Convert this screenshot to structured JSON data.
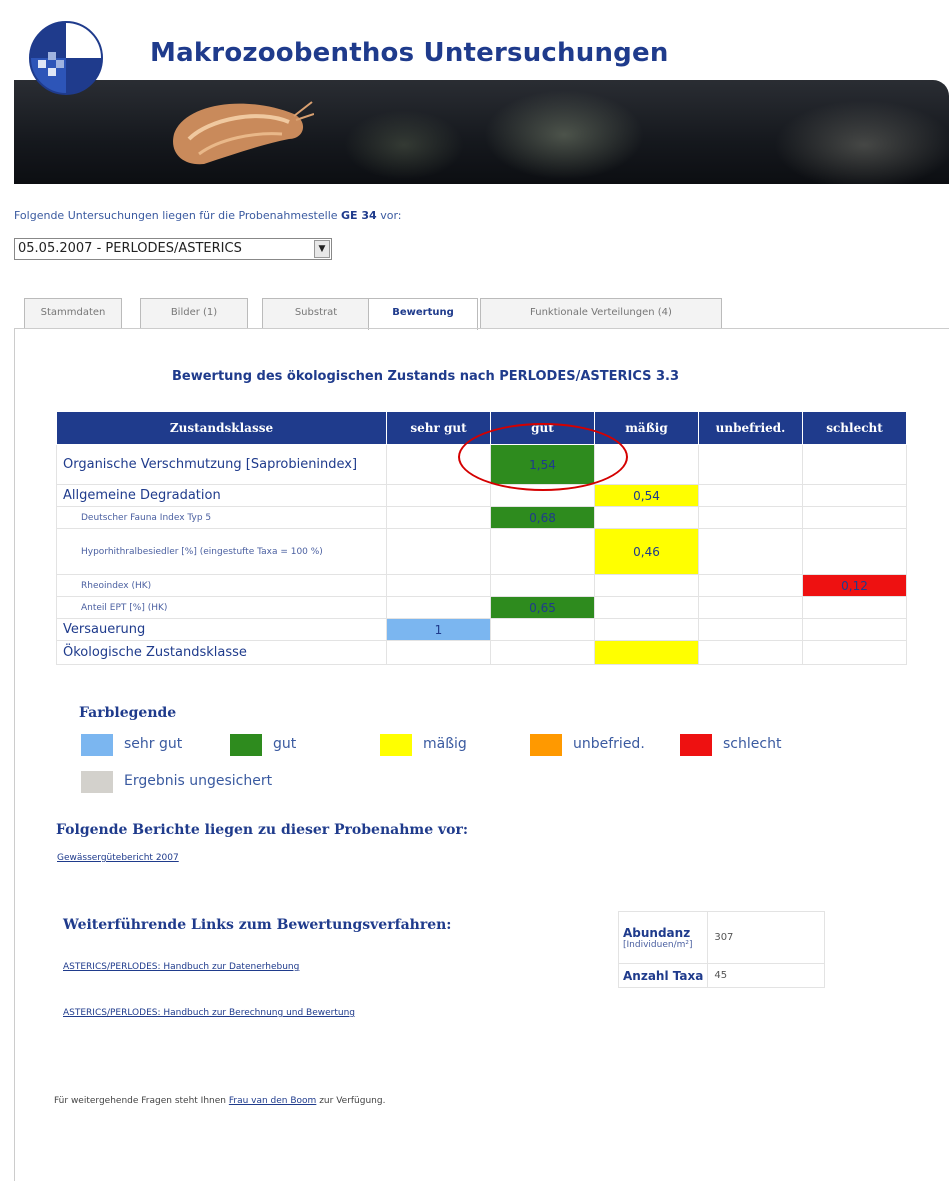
{
  "header": {
    "title": "Makrozoobenthos Untersuchungen"
  },
  "intro": {
    "text": "Folgende Untersuchungen liegen für die Probenahmestelle",
    "station": "GE 34",
    "suffix": "vor:"
  },
  "sample_select": {
    "value": "05.05.2007 - PERLODES/ASTERICS"
  },
  "tabs": [
    {
      "label": "Stammdaten"
    },
    {
      "label": "Bilder (1)"
    },
    {
      "label": "Substrat"
    },
    {
      "label": "Bewertung"
    },
    {
      "label": "Funktionale Verteilungen (4)"
    }
  ],
  "assessment": {
    "title": "Bewertung des ökologischen Zustands nach PERLODES/ASTERICS 3.3",
    "headers": [
      "Zustandsklasse",
      "sehr gut",
      "gut",
      "mäßig",
      "unbefried.",
      "schlecht"
    ],
    "rows": [
      {
        "label": "Organische Verschmutzung [Saprobienindex]",
        "value": "1,54",
        "class": "gut"
      },
      {
        "label": "Allgemeine Degradation",
        "value": "0,54",
        "class": "mäßig"
      },
      {
        "label": "Deutscher Fauna Index Typ 5",
        "value": "0,68",
        "class": "gut"
      },
      {
        "label": "Hyporhithralbesiedler [%] (eingestufte Taxa = 100 %)",
        "value": "0,46",
        "class": "mäßig"
      },
      {
        "label": "Rheoindex (HK)",
        "value": "0,12",
        "class": "schlecht"
      },
      {
        "label": "Anteil EPT [%] (HK)",
        "value": "0,65",
        "class": "gut"
      },
      {
        "label": "Versauerung",
        "value": "1",
        "class": "sehr gut"
      },
      {
        "label": "Ökologische Zustandsklasse",
        "value": "",
        "class": "mäßig"
      }
    ]
  },
  "legend": {
    "title": "Farblegende",
    "items": [
      {
        "label": "sehr gut",
        "color": "#7bb6f0"
      },
      {
        "label": "gut",
        "color": "#2e8b1e"
      },
      {
        "label": "mäßig",
        "color": "#ffff00"
      },
      {
        "label": "unbefried.",
        "color": "#ff9900"
      },
      {
        "label": "schlecht",
        "color": "#ee1111"
      },
      {
        "label": "Ergebnis ungesichert",
        "color": "#d3d1cc"
      }
    ]
  },
  "reports": {
    "title": "Folgende Berichte liegen zu dieser Probenahme vor:",
    "link": "Gewässergütebericht 2007"
  },
  "links": {
    "title": "Weiterführende Links zum Bewertungsverfahren:",
    "items": [
      "ASTERICS/PERLODES: Handbuch zur Datenerhebung",
      "ASTERICS/PERLODES: Handbuch zur Berechnung und Bewertung"
    ]
  },
  "stats": {
    "abundance_label": "Abundanz",
    "abundance_unit": "[Individuen/m²]",
    "abundance_value": "307",
    "taxa_label": "Anzahl Taxa",
    "taxa_value": "45"
  },
  "footer": {
    "prefix": "Für weitergehende Fragen steht Ihnen",
    "contact": "Frau van den Boom",
    "suffix": "zur Verfügung."
  }
}
